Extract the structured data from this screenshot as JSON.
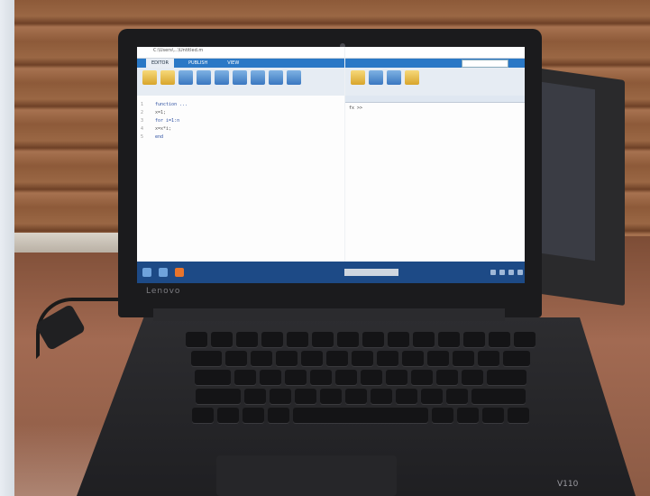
{
  "scene": {
    "laptop_brand": "Lenovo",
    "laptop_model": "V110"
  },
  "matlab": {
    "left_window": {
      "title": "C:\\Users\\...\\Untitled.m",
      "tabs": [
        "EDITOR",
        "PUBLISH",
        "VIEW"
      ],
      "code_lines": [
        {
          "num": "1",
          "text": "function ..."
        },
        {
          "num": "2",
          "text": "x=1;"
        },
        {
          "num": "3",
          "text": "for i=1:n"
        },
        {
          "num": "4",
          "text": "x=x*i;"
        },
        {
          "num": "5",
          "text": "end"
        }
      ]
    },
    "right_window": {
      "command_prompt": "fx >> "
    }
  }
}
